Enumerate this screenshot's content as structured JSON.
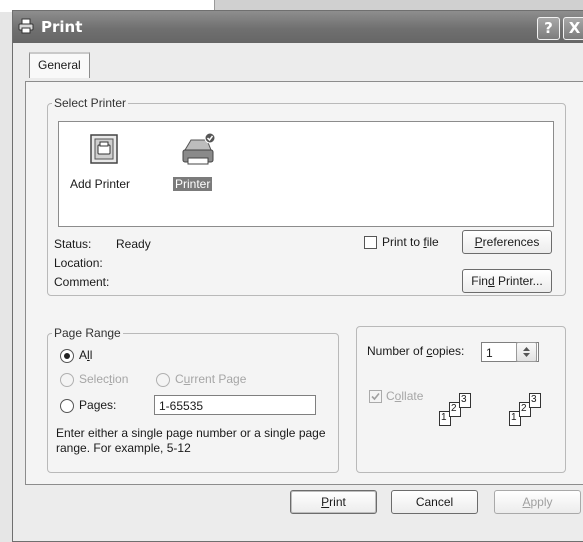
{
  "window": {
    "title": "Print",
    "help_button": "?",
    "close_button": "X"
  },
  "tabs": [
    {
      "label": "General"
    }
  ],
  "select_printer": {
    "legend": "Select Printer",
    "printers": [
      {
        "label": "Add Printer",
        "icon": "add-printer-icon",
        "selected": false
      },
      {
        "label": "Printer",
        "icon": "printer-icon",
        "selected": true
      }
    ],
    "status_label": "Status:",
    "status_value": "Ready",
    "location_label": "Location:",
    "location_value": "",
    "comment_label": "Comment:",
    "comment_value": "",
    "print_to_file": {
      "pre": "Print to ",
      "key": "f",
      "post": "ile",
      "checked": false
    },
    "preferences": {
      "key": "P",
      "rest": "references"
    },
    "find_printer": {
      "pre": "Fin",
      "key": "d",
      "post": " Printer..."
    }
  },
  "page_range": {
    "legend": "Page Range",
    "all": {
      "pre": "A",
      "key": "l",
      "post": "l",
      "selected": true
    },
    "selection": {
      "pre": "Selec",
      "key": "t",
      "post": "ion",
      "enabled": false
    },
    "current_page": {
      "pre": "C",
      "key": "u",
      "post": "rrent Page",
      "enabled": false
    },
    "pages": {
      "pre": "Pa",
      "key": "g",
      "post": "es:",
      "selected": false,
      "value": "1-65535"
    },
    "hint": "Enter either a single page number or a single page range.  For example, 5-12"
  },
  "copies": {
    "label_pre": "Number of ",
    "label_key": "c",
    "label_post": "opies:",
    "value": "1",
    "collate": {
      "pre": "C",
      "key": "o",
      "post": "llate",
      "checked": true,
      "enabled": false
    },
    "illustration_pages": [
      "1",
      "2",
      "3",
      "1",
      "2",
      "3"
    ]
  },
  "buttons": {
    "print": {
      "key": "P",
      "rest": "rint"
    },
    "cancel": {
      "label": "Cancel"
    },
    "apply": {
      "key": "A",
      "rest": "pply",
      "enabled": false
    }
  }
}
